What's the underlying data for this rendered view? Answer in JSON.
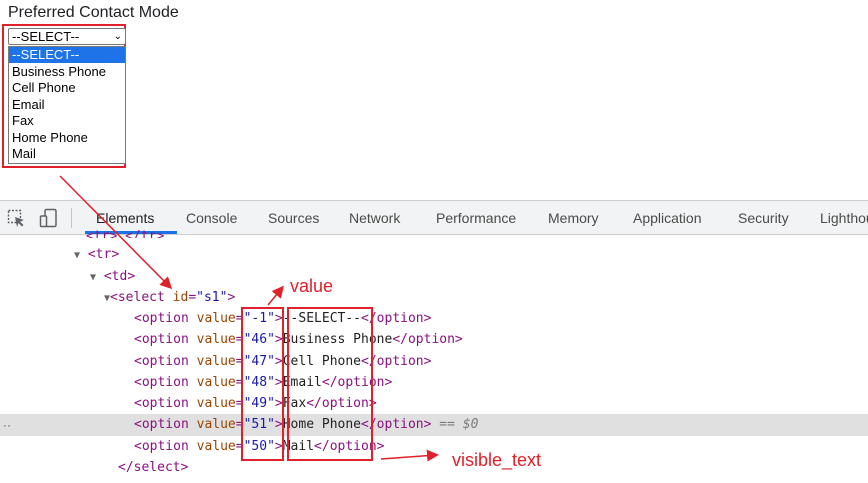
{
  "form": {
    "label": "Preferred Contact Mode",
    "selected": "--SELECT--",
    "options": [
      "--SELECT--",
      "Business Phone",
      "Cell Phone",
      "Email",
      "Fax",
      "Home Phone",
      "Mail"
    ]
  },
  "devtools": {
    "tabs": [
      "Elements",
      "Console",
      "Sources",
      "Network",
      "Performance",
      "Memory",
      "Application",
      "Security",
      "Lighthouse"
    ],
    "active_tab": "Elements",
    "tree": {
      "tr_partial": "<tr>…</tr>",
      "tr": "<tr>",
      "td": "<td>",
      "select_tag": "select",
      "select_attr": "id",
      "select_id": "\"s1\"",
      "select_close": "</select>",
      "option_rows": [
        {
          "value": "\"-1\"",
          "text": "--SELECT--"
        },
        {
          "value": "\"46\"",
          "text": "Business Phone"
        },
        {
          "value": "\"47\"",
          "text": "Cell Phone"
        },
        {
          "value": "\"48\"",
          "text": "Email"
        },
        {
          "value": "\"49\"",
          "text": "Fax"
        },
        {
          "value": "\"51\"",
          "text": "Home Phone"
        },
        {
          "value": "\"50\"",
          "text": "Mail"
        }
      ],
      "selected_marker": "== $0",
      "dots": "··"
    }
  },
  "annotations": {
    "value_label": "value",
    "visible_text_label": "visible_text"
  },
  "colors": {
    "annotation_red": "#e0202a",
    "tag_purple": "#881280",
    "attr_brown": "#994500",
    "value_blue": "#1a1aa6",
    "selected_option_blue": "#1e73e8",
    "active_tab_blue": "#1a73e8"
  }
}
